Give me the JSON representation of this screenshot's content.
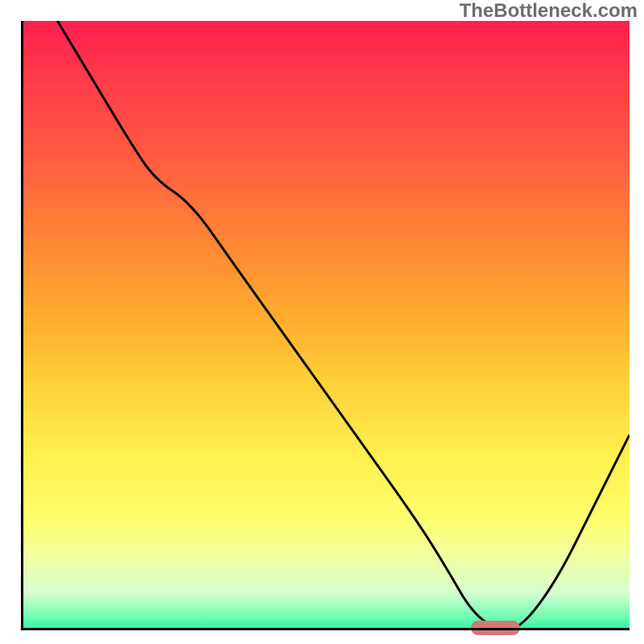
{
  "watermark": "TheBottleneck.com",
  "chart_data": {
    "type": "line",
    "title": "",
    "xlabel": "",
    "ylabel": "",
    "xlim": [
      0,
      100
    ],
    "ylim": [
      0,
      100
    ],
    "grid": false,
    "legend": false,
    "background": "gradient_red_to_green",
    "series": [
      {
        "name": "bottleneck-curve",
        "x": [
          6,
          12,
          18,
          22,
          28,
          35,
          45,
          55,
          65,
          70,
          74,
          78,
          82,
          88,
          94,
          100
        ],
        "y": [
          100,
          90,
          80,
          74,
          70,
          60,
          46,
          32,
          18,
          10,
          3,
          0,
          0,
          8,
          20,
          32
        ]
      }
    ],
    "marker": {
      "name": "optimum-marker",
      "x_start": 74,
      "x_end": 82,
      "y": 0,
      "color": "#d47878"
    },
    "colors": {
      "top": "#ff1f4e",
      "bottom": "#2ef3a1",
      "curve": "#000000",
      "axis": "#000000",
      "marker": "#d47878",
      "watermark": "#6e6e6e"
    }
  }
}
